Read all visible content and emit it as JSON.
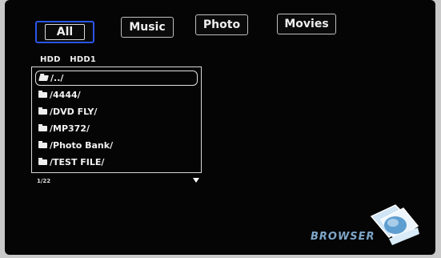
{
  "tabs": [
    {
      "label": "All",
      "active": true
    },
    {
      "label": "Music",
      "active": false
    },
    {
      "label": "Photo",
      "active": false
    },
    {
      "label": "Movies",
      "active": false
    }
  ],
  "path": {
    "device": "HDD",
    "volume": "HDD1"
  },
  "files": [
    {
      "name": "/../",
      "selected": true,
      "icon": "open-folder-icon"
    },
    {
      "name": "/4444/",
      "selected": false,
      "icon": "folder-icon"
    },
    {
      "name": "/DVD FLY/",
      "selected": false,
      "icon": "folder-icon"
    },
    {
      "name": "/MP372/",
      "selected": false,
      "icon": "folder-icon"
    },
    {
      "name": "/Photo Bank/",
      "selected": false,
      "icon": "folder-icon"
    },
    {
      "name": "/TEST FILE/",
      "selected": false,
      "icon": "folder-icon"
    }
  ],
  "page_count": "1/22",
  "logo": {
    "text": "BROWSER",
    "icon": "browser-logo-icon"
  },
  "colors": {
    "background": "#050505",
    "active_tab_border": "#2a55e8",
    "logo_text": "#7ea6c8"
  }
}
